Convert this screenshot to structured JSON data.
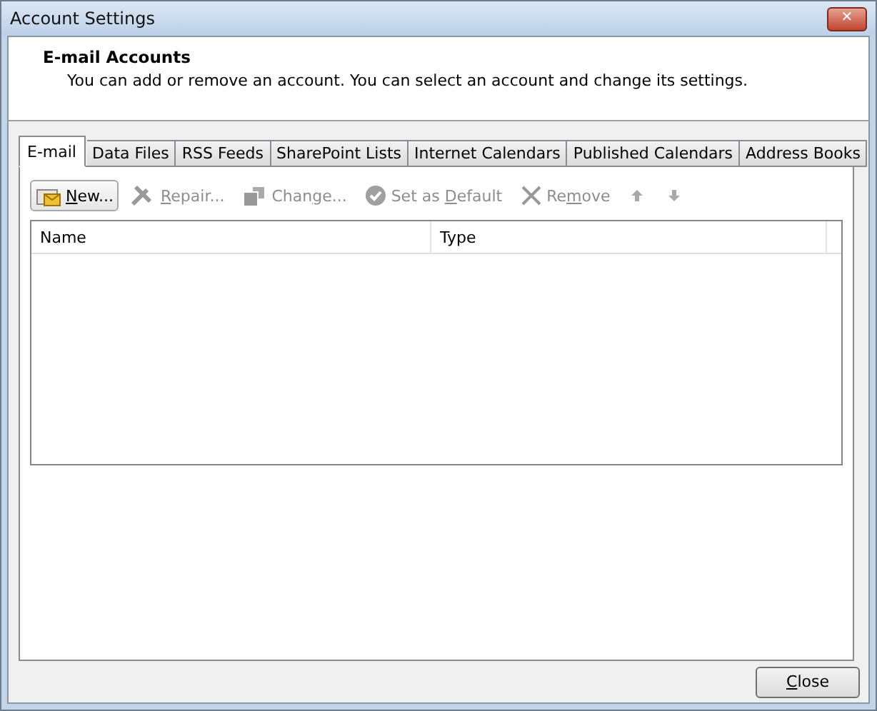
{
  "window": {
    "title": "Account Settings",
    "close_glyph": "✕"
  },
  "header": {
    "title": "E-mail Accounts",
    "description": "You can add or remove an account. You can select an account and change its settings."
  },
  "tabs": [
    {
      "label": "E-mail",
      "selected": true
    },
    {
      "label": "Data Files",
      "selected": false
    },
    {
      "label": "RSS Feeds",
      "selected": false
    },
    {
      "label": "SharePoint Lists",
      "selected": false
    },
    {
      "label": "Internet Calendars",
      "selected": false
    },
    {
      "label": "Published Calendars",
      "selected": false
    },
    {
      "label": "Address Books",
      "selected": false
    }
  ],
  "toolbar": [
    {
      "kind": "new",
      "key": "N",
      "post": "ew...",
      "disabled": false
    },
    {
      "kind": "repair",
      "key": "R",
      "post": "epair...",
      "disabled": true
    },
    {
      "kind": "change",
      "pre": "Chan",
      "key": "g",
      "post": "e...",
      "disabled": true
    },
    {
      "kind": "default",
      "pre": "Set as ",
      "key": "D",
      "post": "efault",
      "disabled": true
    },
    {
      "kind": "remove",
      "pre": "Re",
      "key": "m",
      "post": "ove",
      "disabled": true
    },
    {
      "kind": "up",
      "disabled": true
    },
    {
      "kind": "down",
      "disabled": true
    }
  ],
  "table": {
    "columns": [
      "Name",
      "Type"
    ]
  },
  "footer": {
    "close": {
      "key": "C",
      "post": "lose"
    }
  }
}
